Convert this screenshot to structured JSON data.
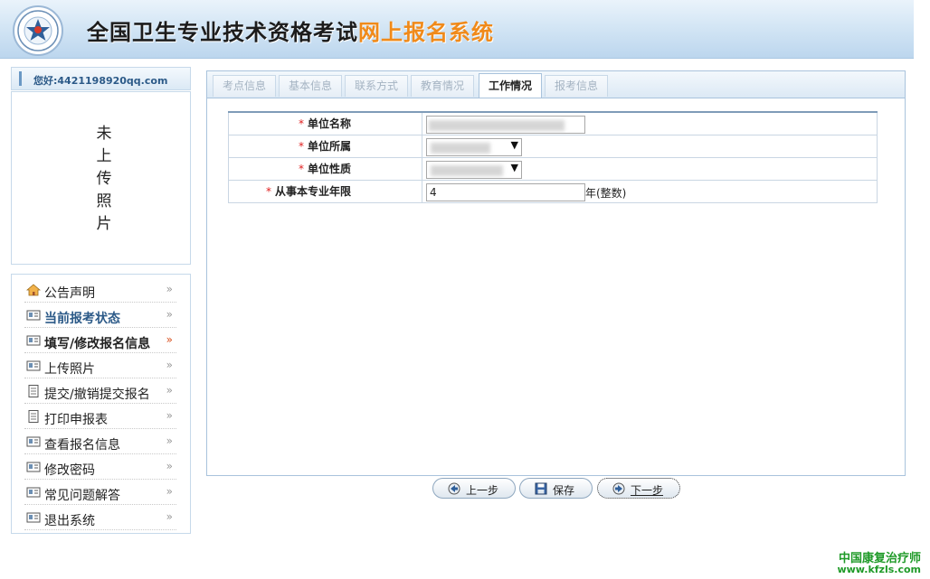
{
  "header": {
    "title_main": "全国卫生专业技术资格考试",
    "title_highlight": "网上报名系统",
    "logo_icon": "exam-logo-icon"
  },
  "user": {
    "greeting": "您好:4421198920qq.com"
  },
  "photo": {
    "placeholder": "未上传照片"
  },
  "menu": {
    "items": [
      {
        "label": "公告声明",
        "icon": "home-icon"
      },
      {
        "label": "当前报考状态",
        "icon": "card-icon"
      },
      {
        "label": "填写/修改报名信息",
        "icon": "card-icon"
      },
      {
        "label": "上传照片",
        "icon": "card-icon"
      },
      {
        "label": "提交/撤销提交报名",
        "icon": "document-icon"
      },
      {
        "label": "打印申报表",
        "icon": "document-icon"
      },
      {
        "label": "查看报名信息",
        "icon": "card-icon"
      },
      {
        "label": "修改密码",
        "icon": "card-icon"
      },
      {
        "label": "常见问题解答",
        "icon": "card-icon"
      },
      {
        "label": "退出系统",
        "icon": "card-icon"
      }
    ],
    "active_index": 2
  },
  "tabs": [
    {
      "label": "考点信息",
      "active": false
    },
    {
      "label": "基本信息",
      "active": false
    },
    {
      "label": "联系方式",
      "active": false
    },
    {
      "label": "教育情况",
      "active": false
    },
    {
      "label": "工作情况",
      "active": true
    },
    {
      "label": "报考信息",
      "active": false
    }
  ],
  "form": {
    "required_mark": "*",
    "rows": [
      {
        "label": "单位名称",
        "type": "text",
        "value": ""
      },
      {
        "label": "单位所属",
        "type": "select",
        "value": ""
      },
      {
        "label": "单位性质",
        "type": "select",
        "value": ""
      },
      {
        "label": "从事本专业年限",
        "type": "text",
        "value": "4",
        "unit": "年(整数)"
      }
    ]
  },
  "buttons": {
    "prev": "上一步",
    "save": "保存",
    "next": "下一步"
  },
  "watermark": {
    "line1": "中国康复治疗师",
    "line2": "www.kfzls.com"
  },
  "colors": {
    "title_highlight": "#f08a1a",
    "required": "#e02020",
    "watermark": "#1f9a28"
  }
}
